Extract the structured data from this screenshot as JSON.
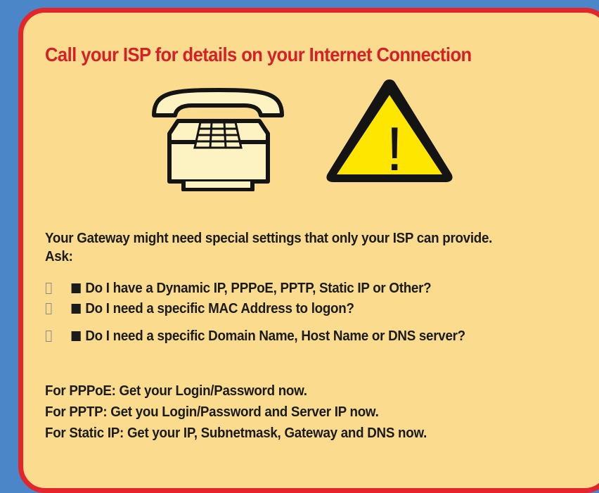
{
  "title": "Call your ISP for details on your Internet Connection",
  "icons": [
    "telephone-icon",
    "warning-icon"
  ],
  "warning_glyph": "!",
  "intro": "Your Gateway might need special settings that only your ISP can provide.",
  "ask": "Ask:",
  "questions": [
    "Do I have a Dynamic IP, PPPoE, PPTP, Static IP or Other?",
    "Do I need a specific MAC Address to logon?",
    "Do I need a specific Domain Name, Host Name or DNS server?"
  ],
  "instructions": [
    "For PPPoE:  Get your Login/Password now.",
    "For PPTP:  Get you Login/Password and Server IP now.",
    "For Static IP:  Get your IP, Subnetmask, Gateway and DNS now."
  ],
  "colors": {
    "background": "#4a86c8",
    "card": "#fbdc8f",
    "border": "#e3262c",
    "title": "#d42027",
    "warning": "#ffe600"
  }
}
